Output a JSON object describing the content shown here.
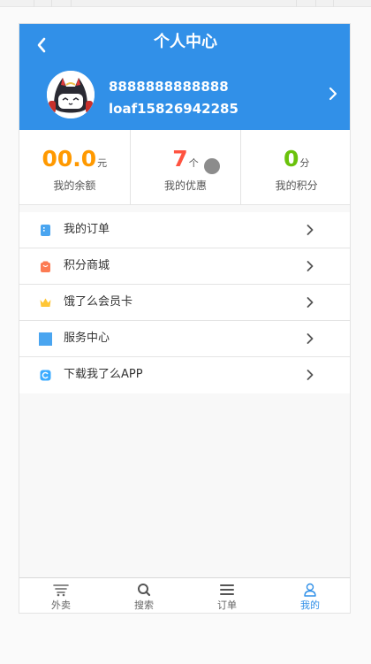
{
  "header": {
    "title": "个人中心"
  },
  "user": {
    "name": "8888888888888",
    "account": "loaf15826942285"
  },
  "stats": [
    {
      "value": "00.0",
      "unit": "元",
      "label": "我的余额",
      "color": "#f90"
    },
    {
      "value": "7",
      "unit": "个",
      "label": "我的优惠",
      "color": "#ff5340"
    },
    {
      "value": "0",
      "unit": "分",
      "label": "我的积分",
      "color": "#6ac20b"
    }
  ],
  "menu": [
    {
      "label": "我的订单",
      "icon": "order-icon",
      "color": "#4aa5f0"
    },
    {
      "label": "积分商城",
      "icon": "shop-bag-icon",
      "color": "#fc7b53"
    },
    {
      "label": "饿了么会员卡",
      "icon": "crown-icon",
      "color": "#ffc636"
    },
    {
      "label": "服务中心",
      "icon": "service-icon",
      "color": "#4aa5f0"
    },
    {
      "label": "下载我了么APP",
      "icon": "app-download-icon",
      "color": "#3cabff"
    }
  ],
  "tabs": [
    {
      "label": "外卖",
      "icon": "takeaway-icon",
      "active": false
    },
    {
      "label": "搜索",
      "icon": "search-icon",
      "active": false
    },
    {
      "label": "订单",
      "icon": "list-icon",
      "active": false
    },
    {
      "label": "我的",
      "icon": "user-icon",
      "active": true
    }
  ],
  "colors": {
    "accent": "#3190e8"
  }
}
